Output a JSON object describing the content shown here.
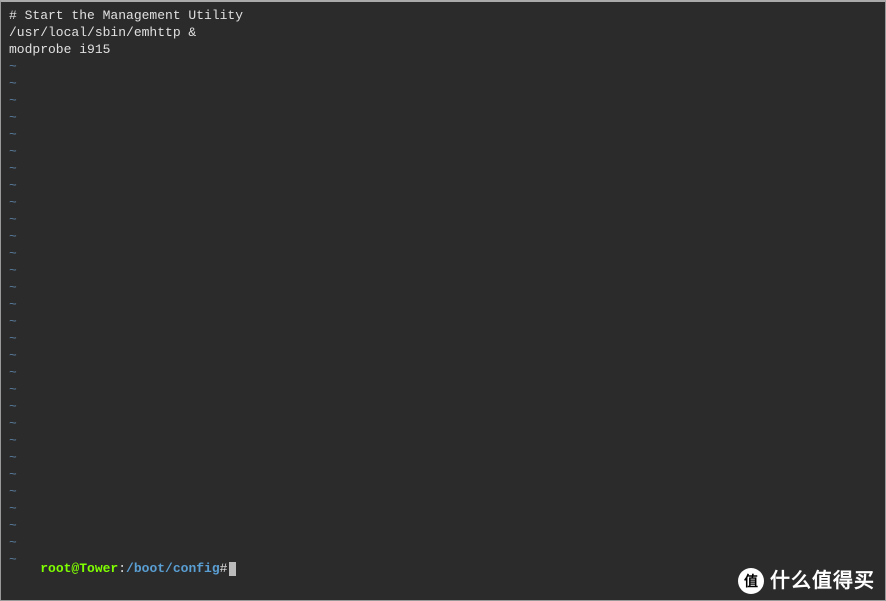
{
  "editor": {
    "lines": [
      "# Start the Management Utility",
      "/usr/local/sbin/emhttp &",
      "modprobe i915"
    ],
    "tilde_count": 30,
    "tilde_char": "~"
  },
  "prompt": {
    "user_host": "root@Tower",
    "separator": ":",
    "path": "/boot/config",
    "suffix": "#"
  },
  "watermark": {
    "badge": "值",
    "text": "什么值得买"
  }
}
